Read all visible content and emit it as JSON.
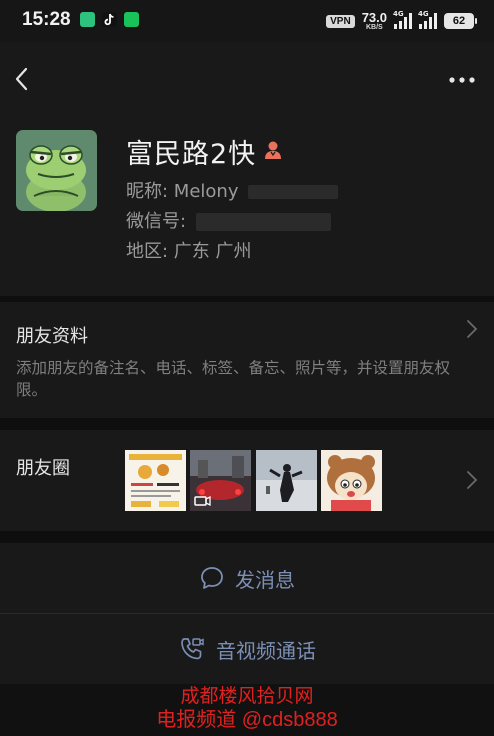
{
  "status_bar": {
    "time": "15:28",
    "vpn_label": "VPN",
    "net_speed": "73.0",
    "net_speed_unit": "KB/S",
    "sig1_label": "4G",
    "sig2_label": "4G",
    "battery": "62"
  },
  "profile": {
    "name": "富民路2快",
    "nickname_label": "昵称: ",
    "nickname_value": "Melony",
    "wechat_id_label": "微信号: ",
    "region_label": "地区: ",
    "region_value": "广东  广州"
  },
  "friend_info": {
    "title": "朋友资料",
    "description": "添加朋友的备注名、电话、标签、备忘、照片等，并设置朋友权限。"
  },
  "moments": {
    "title": "朋友圈"
  },
  "actions": {
    "message": "发消息",
    "call": "音视频通话"
  },
  "watermark": {
    "line1": "成都楼风拾贝网",
    "line2": "电报频道 @cdsb888"
  },
  "colors": {
    "background": "#111111",
    "card": "#191919",
    "link_blue": "#7b8fb5",
    "watermark_red": "#e0211f"
  }
}
